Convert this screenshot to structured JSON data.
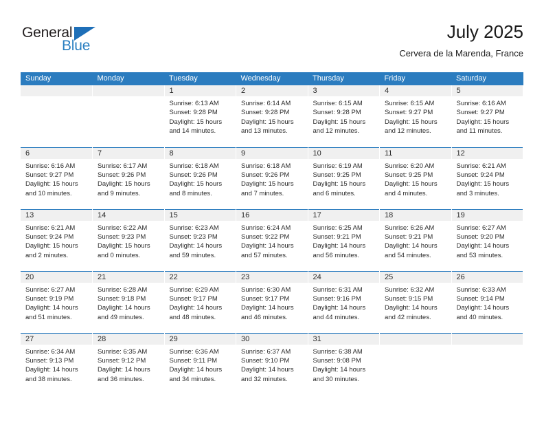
{
  "brand": {
    "line1": "General",
    "line2": "Blue",
    "triangle_icon": "triangle-icon",
    "color_dark": "#231f20",
    "color_blue": "#2a7fc1"
  },
  "header": {
    "title": "July 2025",
    "subtitle": "Cervera de la Marenda, France"
  },
  "theme": {
    "header_blue": "#2b7cbf",
    "daynum_gray": "#f0f0f0"
  },
  "calendar": {
    "weekday_headers": [
      "Sunday",
      "Monday",
      "Tuesday",
      "Wednesday",
      "Thursday",
      "Friday",
      "Saturday"
    ],
    "weeks": [
      [
        {
          "day": "",
          "lines": []
        },
        {
          "day": "",
          "lines": []
        },
        {
          "day": "1",
          "lines": [
            "Sunrise: 6:13 AM",
            "Sunset: 9:28 PM",
            "Daylight: 15 hours",
            "and 14 minutes."
          ]
        },
        {
          "day": "2",
          "lines": [
            "Sunrise: 6:14 AM",
            "Sunset: 9:28 PM",
            "Daylight: 15 hours",
            "and 13 minutes."
          ]
        },
        {
          "day": "3",
          "lines": [
            "Sunrise: 6:15 AM",
            "Sunset: 9:28 PM",
            "Daylight: 15 hours",
            "and 12 minutes."
          ]
        },
        {
          "day": "4",
          "lines": [
            "Sunrise: 6:15 AM",
            "Sunset: 9:27 PM",
            "Daylight: 15 hours",
            "and 12 minutes."
          ]
        },
        {
          "day": "5",
          "lines": [
            "Sunrise: 6:16 AM",
            "Sunset: 9:27 PM",
            "Daylight: 15 hours",
            "and 11 minutes."
          ]
        }
      ],
      [
        {
          "day": "6",
          "lines": [
            "Sunrise: 6:16 AM",
            "Sunset: 9:27 PM",
            "Daylight: 15 hours",
            "and 10 minutes."
          ]
        },
        {
          "day": "7",
          "lines": [
            "Sunrise: 6:17 AM",
            "Sunset: 9:26 PM",
            "Daylight: 15 hours",
            "and 9 minutes."
          ]
        },
        {
          "day": "8",
          "lines": [
            "Sunrise: 6:18 AM",
            "Sunset: 9:26 PM",
            "Daylight: 15 hours",
            "and 8 minutes."
          ]
        },
        {
          "day": "9",
          "lines": [
            "Sunrise: 6:18 AM",
            "Sunset: 9:26 PM",
            "Daylight: 15 hours",
            "and 7 minutes."
          ]
        },
        {
          "day": "10",
          "lines": [
            "Sunrise: 6:19 AM",
            "Sunset: 9:25 PM",
            "Daylight: 15 hours",
            "and 6 minutes."
          ]
        },
        {
          "day": "11",
          "lines": [
            "Sunrise: 6:20 AM",
            "Sunset: 9:25 PM",
            "Daylight: 15 hours",
            "and 4 minutes."
          ]
        },
        {
          "day": "12",
          "lines": [
            "Sunrise: 6:21 AM",
            "Sunset: 9:24 PM",
            "Daylight: 15 hours",
            "and 3 minutes."
          ]
        }
      ],
      [
        {
          "day": "13",
          "lines": [
            "Sunrise: 6:21 AM",
            "Sunset: 9:24 PM",
            "Daylight: 15 hours",
            "and 2 minutes."
          ]
        },
        {
          "day": "14",
          "lines": [
            "Sunrise: 6:22 AM",
            "Sunset: 9:23 PM",
            "Daylight: 15 hours",
            "and 0 minutes."
          ]
        },
        {
          "day": "15",
          "lines": [
            "Sunrise: 6:23 AM",
            "Sunset: 9:23 PM",
            "Daylight: 14 hours",
            "and 59 minutes."
          ]
        },
        {
          "day": "16",
          "lines": [
            "Sunrise: 6:24 AM",
            "Sunset: 9:22 PM",
            "Daylight: 14 hours",
            "and 57 minutes."
          ]
        },
        {
          "day": "17",
          "lines": [
            "Sunrise: 6:25 AM",
            "Sunset: 9:21 PM",
            "Daylight: 14 hours",
            "and 56 minutes."
          ]
        },
        {
          "day": "18",
          "lines": [
            "Sunrise: 6:26 AM",
            "Sunset: 9:21 PM",
            "Daylight: 14 hours",
            "and 54 minutes."
          ]
        },
        {
          "day": "19",
          "lines": [
            "Sunrise: 6:27 AM",
            "Sunset: 9:20 PM",
            "Daylight: 14 hours",
            "and 53 minutes."
          ]
        }
      ],
      [
        {
          "day": "20",
          "lines": [
            "Sunrise: 6:27 AM",
            "Sunset: 9:19 PM",
            "Daylight: 14 hours",
            "and 51 minutes."
          ]
        },
        {
          "day": "21",
          "lines": [
            "Sunrise: 6:28 AM",
            "Sunset: 9:18 PM",
            "Daylight: 14 hours",
            "and 49 minutes."
          ]
        },
        {
          "day": "22",
          "lines": [
            "Sunrise: 6:29 AM",
            "Sunset: 9:17 PM",
            "Daylight: 14 hours",
            "and 48 minutes."
          ]
        },
        {
          "day": "23",
          "lines": [
            "Sunrise: 6:30 AM",
            "Sunset: 9:17 PM",
            "Daylight: 14 hours",
            "and 46 minutes."
          ]
        },
        {
          "day": "24",
          "lines": [
            "Sunrise: 6:31 AM",
            "Sunset: 9:16 PM",
            "Daylight: 14 hours",
            "and 44 minutes."
          ]
        },
        {
          "day": "25",
          "lines": [
            "Sunrise: 6:32 AM",
            "Sunset: 9:15 PM",
            "Daylight: 14 hours",
            "and 42 minutes."
          ]
        },
        {
          "day": "26",
          "lines": [
            "Sunrise: 6:33 AM",
            "Sunset: 9:14 PM",
            "Daylight: 14 hours",
            "and 40 minutes."
          ]
        }
      ],
      [
        {
          "day": "27",
          "lines": [
            "Sunrise: 6:34 AM",
            "Sunset: 9:13 PM",
            "Daylight: 14 hours",
            "and 38 minutes."
          ]
        },
        {
          "day": "28",
          "lines": [
            "Sunrise: 6:35 AM",
            "Sunset: 9:12 PM",
            "Daylight: 14 hours",
            "and 36 minutes."
          ]
        },
        {
          "day": "29",
          "lines": [
            "Sunrise: 6:36 AM",
            "Sunset: 9:11 PM",
            "Daylight: 14 hours",
            "and 34 minutes."
          ]
        },
        {
          "day": "30",
          "lines": [
            "Sunrise: 6:37 AM",
            "Sunset: 9:10 PM",
            "Daylight: 14 hours",
            "and 32 minutes."
          ]
        },
        {
          "day": "31",
          "lines": [
            "Sunrise: 6:38 AM",
            "Sunset: 9:08 PM",
            "Daylight: 14 hours",
            "and 30 minutes."
          ]
        },
        {
          "day": "",
          "lines": []
        },
        {
          "day": "",
          "lines": []
        }
      ]
    ]
  }
}
